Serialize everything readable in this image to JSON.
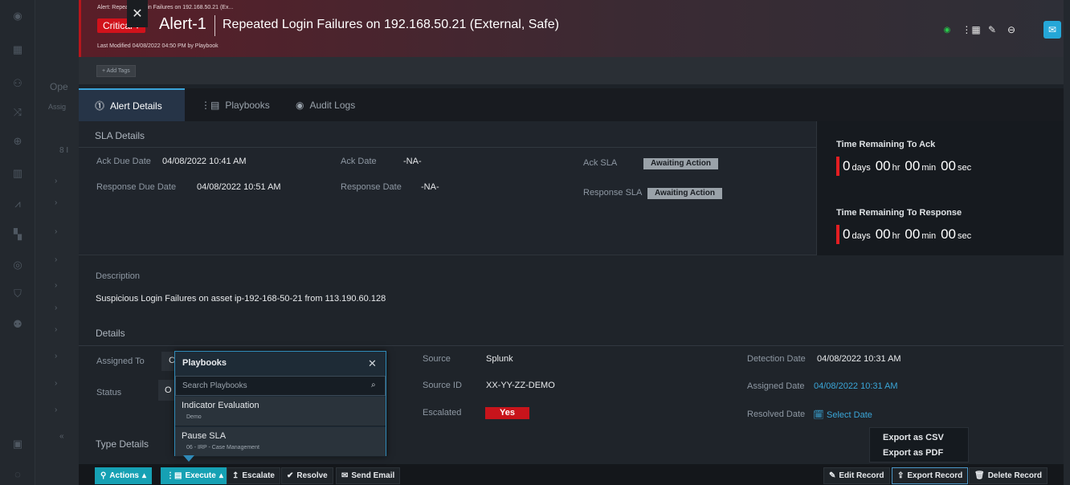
{
  "background": {
    "panel_text": [
      "Ope",
      "Assig",
      "8 I"
    ],
    "nav_icons": [
      "logo-icon",
      "dashboard-icon",
      "users-icon",
      "shuffle-icon",
      "target-icon",
      "building-icon",
      "chart-icon",
      "grid-icon",
      "bullseye-icon",
      "shield-icon",
      "team-icon",
      "device-icon",
      "info-icon"
    ]
  },
  "header": {
    "breadcrumb": "Alert: Repeated Login Failures on 192.168.50.21 (Ex...",
    "severity": "Critical",
    "alert_id": "Alert-1",
    "title": "Repeated Login Failures on 192.168.50.21 (External, Safe)",
    "last_modified": "Last Modified 04/08/2022 04:50 PM by Playbook",
    "close": "✕",
    "status_color": "#27c94a"
  },
  "tags": {
    "add_label": "+ Add Tags"
  },
  "tabs": [
    {
      "label": "Alert Details",
      "icon": "alert-circle-icon"
    },
    {
      "label": "Playbooks",
      "icon": "playbook-icon"
    },
    {
      "label": "Audit Logs",
      "icon": "eye-icon"
    }
  ],
  "sla": {
    "title": "SLA Details",
    "ack_due_label": "Ack Due Date",
    "ack_due_value": "04/08/2022 10:41 AM",
    "ack_date_label": "Ack Date",
    "ack_date_value": "-NA-",
    "ack_sla_label": "Ack SLA",
    "ack_sla_value": "Awaiting Action",
    "resp_due_label": "Response Due Date",
    "resp_due_value": "04/08/2022 10:51 AM",
    "resp_date_label": "Response Date",
    "resp_date_value": "-NA-",
    "resp_sla_label": "Response SLA",
    "resp_sla_value": "Awaiting Action"
  },
  "timers": {
    "ack_title": "Time Remaining To Ack",
    "resp_title": "Time Remaining To Response",
    "days": "0",
    "days_unit": "days",
    "hr": "00",
    "hr_unit": "hr",
    "min": "00",
    "min_unit": "min",
    "sec": "00",
    "sec_unit": "sec"
  },
  "description": {
    "label": "Description",
    "text": "Suspicious Login Failures on asset ip-192-168-50-21 from 113.190.60.128"
  },
  "details": {
    "title": "Details",
    "assigned_to_label": "Assigned To",
    "assigned_to_value": "C",
    "status_label": "Status",
    "status_value": "O",
    "source_label": "Source",
    "source_value": "Splunk",
    "source_id_label": "Source ID",
    "source_id_value": "XX-YY-ZZ-DEMO",
    "escalated_label": "Escalated",
    "escalated_value": "Yes",
    "detection_label": "Detection Date",
    "detection_value": "04/08/2022 10:31 AM",
    "assigned_date_label": "Assigned Date",
    "assigned_date_value": "04/08/2022 10:31 AM",
    "resolved_label": "Resolved Date",
    "resolved_value": "Select Date"
  },
  "type_details": {
    "title": "Type Details"
  },
  "playbook_popup": {
    "title": "Playbooks",
    "close": "✕",
    "search_placeholder": "Search Playbooks",
    "items": [
      {
        "name": "Indicator Evaluation",
        "sub": "Demo"
      },
      {
        "name": "Pause SLA",
        "sub": "06 - IRP - Case Management"
      }
    ]
  },
  "export_menu": {
    "csv": "Export as CSV",
    "pdf": "Export as PDF"
  },
  "footer": {
    "actions": "Actions",
    "execute": "Execute",
    "escalate": "Escalate",
    "resolve": "Resolve",
    "send_email": "Send Email",
    "edit_record": "Edit Record",
    "export_record": "Export Record",
    "delete_record": "Delete Record"
  }
}
